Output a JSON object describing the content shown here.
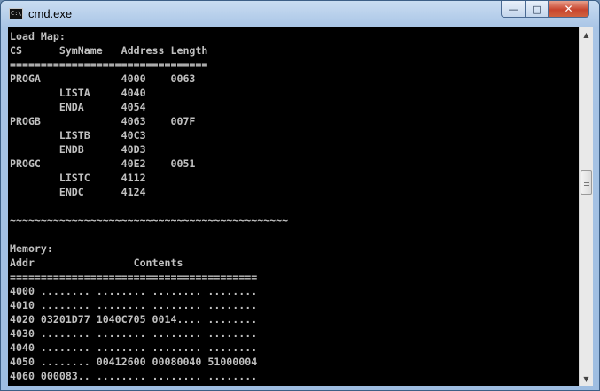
{
  "window": {
    "title": "cmd.exe",
    "icon": "cmd-icon",
    "icon_glyph": "C:\\",
    "controls": {
      "minimize": "—",
      "maximize": "□",
      "close": "✕"
    }
  },
  "console": {
    "lines": [
      "Load Map:",
      "CS      SymName   Address Length",
      "================================",
      "PROGA             4000    0063",
      "        LISTA     4040",
      "        ENDA      4054",
      "PROGB             4063    007F",
      "        LISTB     40C3",
      "        ENDB      40D3",
      "PROGC             40E2    0051",
      "        LISTC     4112",
      "        ENDC      4124",
      "",
      "~~~~~~~~~~~~~~~~~~~~~~~~~~~~~~~~~~~~~~~~~~~~~",
      "",
      "Memory:",
      "Addr                Contents",
      "========================================",
      "4000 ........ ........ ........ ........",
      "4010 ........ ........ ........ ........",
      "4020 03201D77 1040C705 0014.... ........",
      "4030 ........ ........ ........ ........",
      "4040 ........ ........ ........ ........",
      "4050 ........ 00412600 00080040 51000004",
      "4060 000083.. ........ ........ ........"
    ]
  },
  "scrollbar": {
    "up_arrow": "▲",
    "down_arrow": "▼",
    "position": 0.42
  }
}
